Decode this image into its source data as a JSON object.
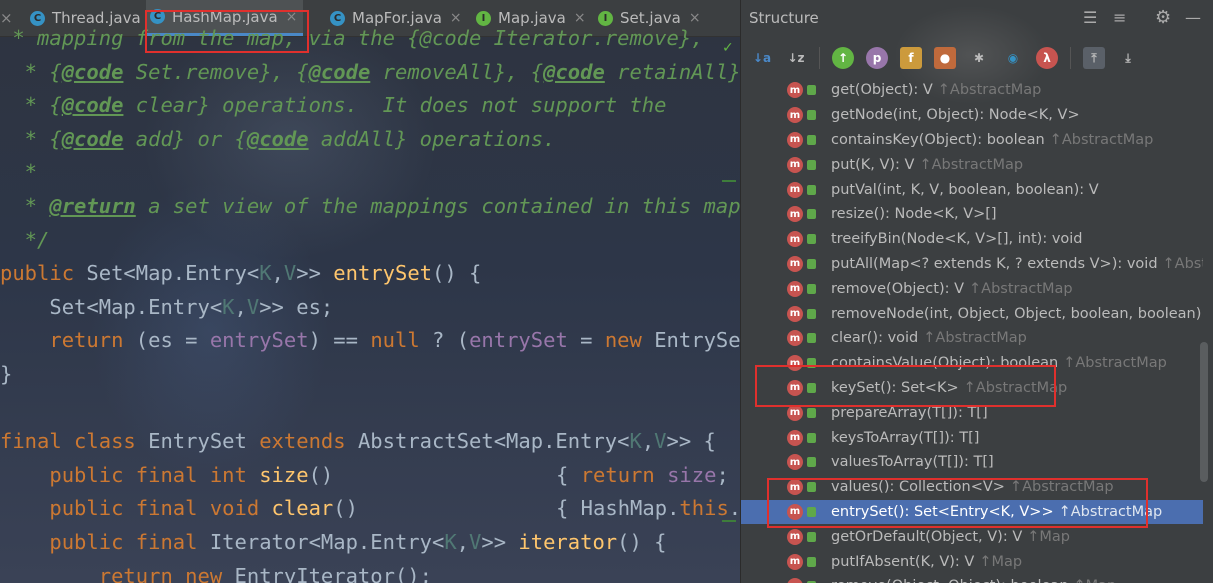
{
  "tabs": [
    {
      "label": "Thread.java",
      "icon": "class-icon",
      "color": "#3592c4"
    },
    {
      "label": "HashMap.java",
      "icon": "class-icon",
      "color": "#3592c4",
      "active": true
    },
    {
      "label": "MapFor.java",
      "icon": "class-icon",
      "color": "#3592c4"
    },
    {
      "label": "Map.java",
      "icon": "interface-icon",
      "color": "#62b543"
    },
    {
      "label": "Set.java",
      "icon": "interface-icon",
      "color": "#62b543"
    }
  ],
  "close_glyph": "×",
  "code": {
    "l0": " * mapping from the map, via the {@code Iterator.remove},",
    "l1a": "  * ",
    "l1": [
      "{",
      "@code",
      " Set.remove}, {",
      "@code",
      " removeAll}, {",
      "@code",
      " retainAll}"
    ],
    "l2": [
      "  * {",
      "@code",
      " clear} operations.  It does not support the"
    ],
    "l3": [
      "  * {",
      "@code",
      " add} or {",
      "@code",
      " addAll} operations."
    ],
    "l4": "  *",
    "l5": [
      "  * ",
      "@return",
      " a set view of the mappings contained in this map"
    ],
    "l6": "  */",
    "l7": [
      "public ",
      "Set<Map.Entry<",
      "K",
      ",",
      "V",
      ">> ",
      "entrySet",
      "() {"
    ],
    "l8": [
      "    Set<Map.Entry<",
      "K",
      ",",
      "V",
      ">> es;"
    ],
    "l9": [
      "    ",
      "return ",
      "(es = ",
      "entrySet",
      ") == ",
      "null",
      " ? (",
      "entrySet",
      " = ",
      "new ",
      "EntrySet"
    ],
    "l10": "}",
    "l12": [
      "final class ",
      "EntrySet ",
      "extends ",
      "AbstractSet<Map.Entry<",
      "K",
      ",",
      "V",
      ">> {"
    ],
    "l13": [
      "    ",
      "public final int ",
      "size",
      "()",
      "{ ",
      "return ",
      "size",
      "; }"
    ],
    "l14": [
      "    ",
      "public final void ",
      "clear",
      "()",
      "{ HashMap.",
      "this",
      "."
    ],
    "l15": [
      "    ",
      "public final ",
      "Iterator<Map.Entry<",
      "K",
      ",",
      "V",
      ">> ",
      "iterator",
      "() {"
    ],
    "l16": [
      "        ",
      "return new ",
      "EntryIterator();"
    ]
  },
  "structure": {
    "title": "Structure",
    "header_icons": [
      "expand-all-icon",
      "collapse-all-icon",
      "settings-icon",
      "minimize-icon"
    ],
    "toolbar_labels": [
      "p",
      "f",
      "λ"
    ],
    "items": [
      {
        "sig": "get(Object): V",
        "inh": "↑AbstractMap"
      },
      {
        "sig": "getNode(int, Object): Node<K, V>",
        "inh": ""
      },
      {
        "sig": "containsKey(Object): boolean",
        "inh": "↑AbstractMap"
      },
      {
        "sig": "put(K, V): V",
        "inh": "↑AbstractMap"
      },
      {
        "sig": "putVal(int, K, V, boolean, boolean): V",
        "inh": ""
      },
      {
        "sig": "resize(): Node<K, V>[]",
        "inh": ""
      },
      {
        "sig": "treeifyBin(Node<K, V>[], int): void",
        "inh": ""
      },
      {
        "sig": "putAll(Map<? extends K, ? extends V>): void",
        "inh": "↑AbstractMap"
      },
      {
        "sig": "remove(Object): V",
        "inh": "↑AbstractMap"
      },
      {
        "sig": "removeNode(int, Object, Object, boolean, boolean): Node",
        "inh": ""
      },
      {
        "sig": "clear(): void",
        "inh": "↑AbstractMap"
      },
      {
        "sig": "containsValue(Object): boolean",
        "inh": "↑AbstractMap"
      },
      {
        "sig": "keySet(): Set<K>",
        "inh": "↑AbstractMap"
      },
      {
        "sig": "prepareArray(T[]): T[]",
        "inh": ""
      },
      {
        "sig": "keysToArray(T[]): T[]",
        "inh": ""
      },
      {
        "sig": "valuesToArray(T[]): T[]",
        "inh": ""
      },
      {
        "sig": "values(): Collection<V>",
        "inh": "↑AbstractMap"
      },
      {
        "sig": "entrySet(): Set<Entry<K, V>>",
        "inh": "↑AbstractMap",
        "selected": true
      },
      {
        "sig": "getOrDefault(Object, V): V",
        "inh": "↑Map"
      },
      {
        "sig": "putIfAbsent(K, V): V",
        "inh": "↑Map"
      },
      {
        "sig": "remove(Object, Object): boolean",
        "inh": "↑Map"
      }
    ]
  },
  "colors": {
    "accent": "#4a88c7",
    "selection": "#4b6eaf",
    "highlight_box": "#e0302d",
    "method_icon": "#c75450"
  }
}
